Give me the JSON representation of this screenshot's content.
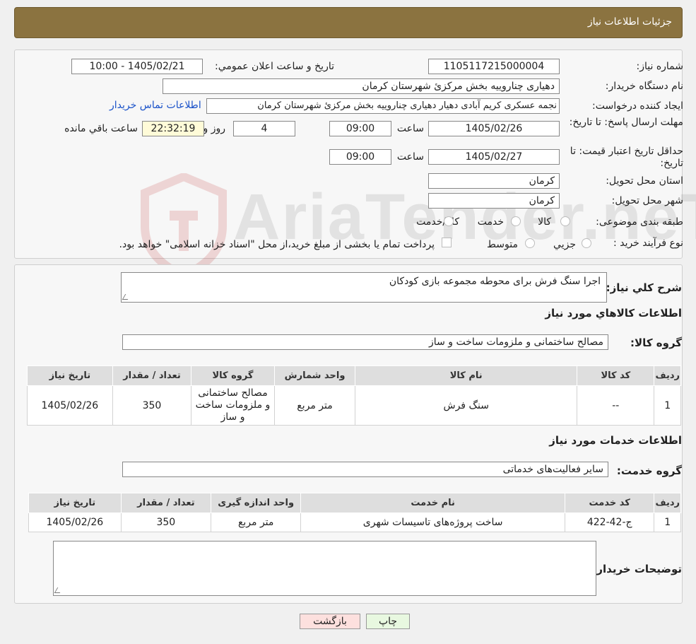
{
  "header": {
    "title": "جزئیات اطلاعات نیاز"
  },
  "watermark": {
    "text": "AriaTender.neT"
  },
  "info": {
    "need_number_label": "شماره نیاز:",
    "need_number": "1105117215000004",
    "announce_label": "تاریخ و ساعت اعلان عمومي:",
    "announce_value": "1405/02/21 - 10:00",
    "buyer_org_label": "نام دستگاه خريدار:",
    "buyer_org": "دهیاری چناروییه بخش مرکزئ شهرستان کرمان",
    "creator_label": "ايجاد کننده درخواست:",
    "creator": "نجمه عسکری کریم آبادی دهیار دهیاری چناروییه بخش مرکزئ شهرستان کرمان",
    "contact_link": "اطلاعات تماس خريدار",
    "deadline_label": "مهلت ارسال پاسخ: تا تاريخ:",
    "deadline_date": "1405/02/26",
    "time_label": "ساعت",
    "deadline_time": "09:00",
    "days": "4",
    "days_label": "روز و",
    "remaining": "22:32:19",
    "remaining_label": "ساعت باقي مانده",
    "validity_label": "حداقل تاريخ اعتبار قيمت: تا تاريخ:",
    "validity_date": "1405/02/27",
    "validity_time": "09:00",
    "province_label": "استان محل تحويل:",
    "province": "کرمان",
    "city_label": "شهر محل تحويل:",
    "city": "کرمان",
    "category_label": "طبقه بندی موضوعی:",
    "category_options": [
      "کالا",
      "خدمت",
      "کالا/خدمت"
    ],
    "process_label": "نوع فرآيند خريد :",
    "process_options": [
      "جزيي",
      "متوسط"
    ],
    "payment_note": "پرداخت تمام يا بخشی از مبلغ خريد،از محل \"اسناد خزانه اسلامی\" خواهد بود."
  },
  "details": {
    "summary_label": "شرح کلي نياز:",
    "summary": "اجرا سنگ فرش برای محوطه مجموعه بازی کودکان",
    "goods_title": "اطلاعات کالاهاي مورد نياز",
    "goods_group_label": "گروه کالا:",
    "goods_group": "مصالح ساختمانی و ملزومات ساخت و ساز",
    "goods_headers": [
      "رديف",
      "کد کالا",
      "نام کالا",
      "واحد شمارش",
      "گروه کالا",
      "تعداد / مقدار",
      "تاريخ نياز"
    ],
    "goods_rows": [
      [
        "1",
        "--",
        "سنگ فرش",
        "متر مربع",
        "مصالح ساختمانی و ملزومات ساخت و ساز",
        "350",
        "1405/02/26"
      ]
    ],
    "services_title": "اطلاعات خدمات مورد نياز",
    "service_group_label": "گروه خدمت:",
    "service_group": "ساير فعاليت‌های خدماتی",
    "service_headers": [
      "رديف",
      "کد خدمت",
      "نام خدمت",
      "واحد اندازه گيری",
      "تعداد / مقدار",
      "تاريخ نياز"
    ],
    "service_rows": [
      [
        "1",
        "ج-42-422",
        "ساخت پروژه‌های تاسيسات شهری",
        "متر مربع",
        "350",
        "1405/02/26"
      ]
    ],
    "buyer_notes_label": "توضيحات خريدار:",
    "buyer_notes": ""
  },
  "buttons": {
    "print": "چاپ",
    "back": "بازگشت"
  }
}
